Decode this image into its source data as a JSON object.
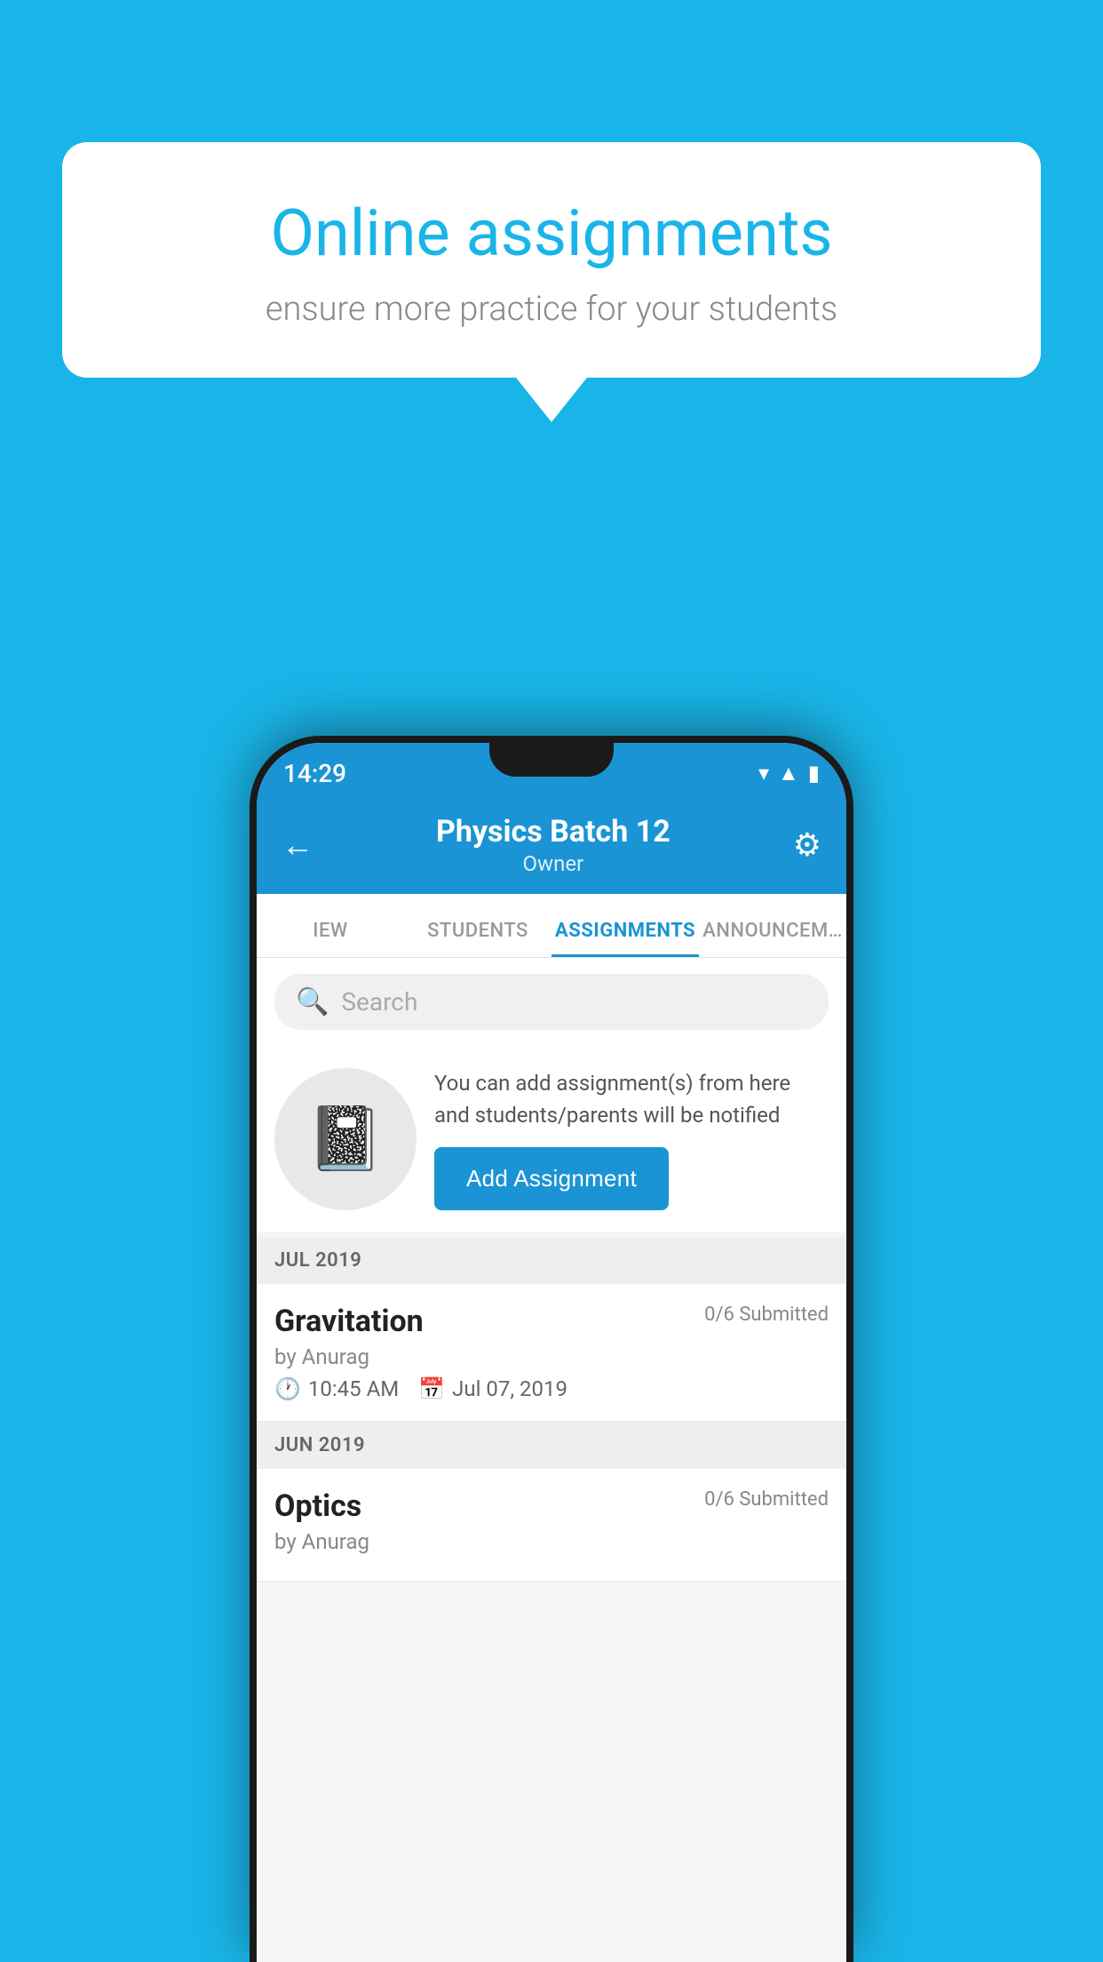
{
  "background_color": "#1ab5e8",
  "speech_bubble": {
    "title": "Online assignments",
    "subtitle": "ensure more practice for your students"
  },
  "status_bar": {
    "time": "14:29",
    "icons": [
      "wifi",
      "signal",
      "battery"
    ]
  },
  "header": {
    "title": "Physics Batch 12",
    "subtitle": "Owner",
    "back_label": "←",
    "gear_label": "⚙"
  },
  "tabs": [
    {
      "label": "IEW",
      "active": false
    },
    {
      "label": "STUDENTS",
      "active": false
    },
    {
      "label": "ASSIGNMENTS",
      "active": true
    },
    {
      "label": "ANNOUNCEM…",
      "active": false
    }
  ],
  "search": {
    "placeholder": "Search"
  },
  "promo": {
    "text": "You can add assignment(s) from here and students/parents will be notified",
    "button_label": "Add Assignment"
  },
  "sections": [
    {
      "month": "JUL 2019",
      "assignments": [
        {
          "name": "Gravitation",
          "submitted": "0/6 Submitted",
          "by": "by Anurag",
          "time": "10:45 AM",
          "date": "Jul 07, 2019"
        }
      ]
    },
    {
      "month": "JUN 2019",
      "assignments": [
        {
          "name": "Optics",
          "submitted": "0/6 Submitted",
          "by": "by Anurag",
          "time": "",
          "date": ""
        }
      ]
    }
  ]
}
